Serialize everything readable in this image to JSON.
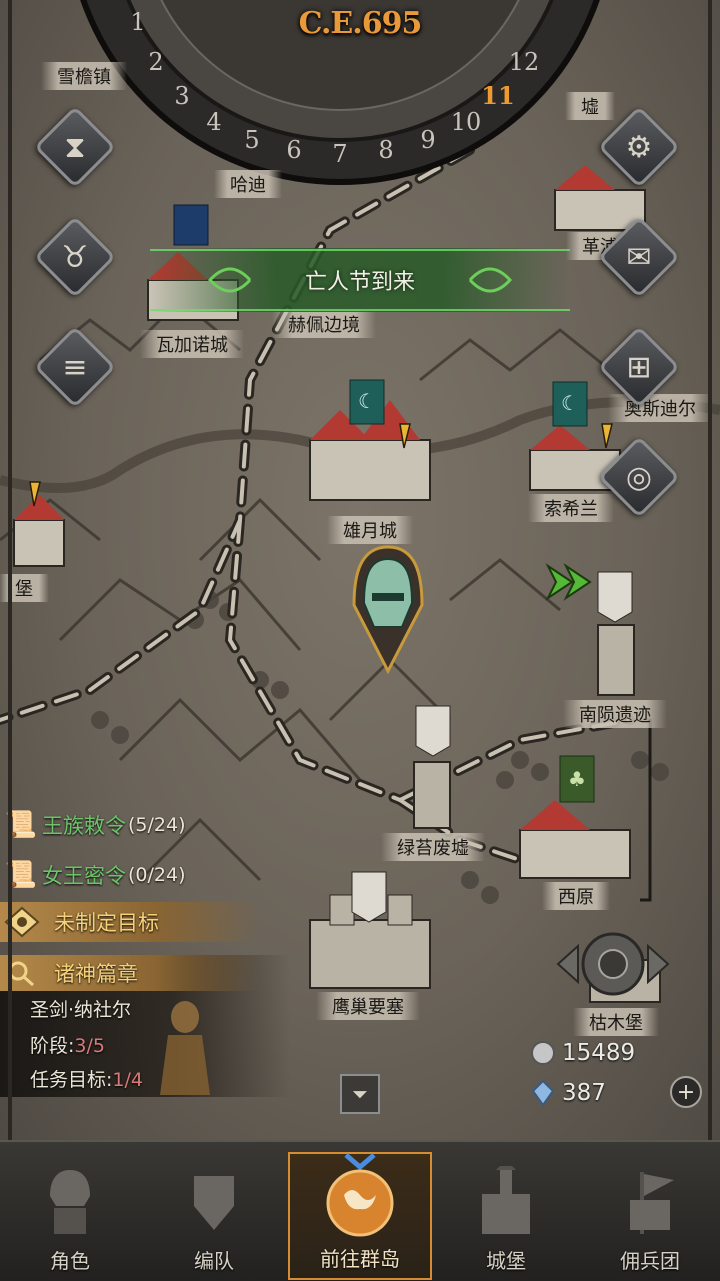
{
  "era": "C.E.695",
  "dial_numbers": [
    "1",
    "2",
    "3",
    "4",
    "5",
    "6",
    "7",
    "8",
    "9",
    "10",
    "11",
    "12"
  ],
  "current_month": "11",
  "festival_banner": "亡人节到来",
  "locations": {
    "xuejizhen": "雪檐镇",
    "hadao": "哈迪",
    "gexu": "墟",
    "gepu": "革浦",
    "wajianuo": "瓦加诺城",
    "hepei": "赫佩边境",
    "aosidier": "奥斯迪尔",
    "xiongyue": "雄月城",
    "suoxilan": "索希兰",
    "bao": "堡",
    "nanyun": "南陨遗迹",
    "lvtai": "绿苔废墟",
    "xiyuan": "西原",
    "yingchao": "鹰巢要塞",
    "kumu": "枯木堡"
  },
  "quests": [
    {
      "title": "王族敕令",
      "count": "(5/24)"
    },
    {
      "title": "女王密令",
      "count": "(0/24)"
    }
  ],
  "goal": "未制定目标",
  "lore": {
    "title": "诸神篇章",
    "name": "圣剑·纳社尔",
    "stage_label": "阶段:",
    "stage_value": "3/5",
    "target_label": "任务目标:",
    "target_value": "1/4"
  },
  "resources": {
    "silver": "15489",
    "crystal": "387"
  },
  "nav": [
    {
      "label": "角色"
    },
    {
      "label": "编队"
    },
    {
      "label": "前往群岛"
    },
    {
      "label": "城堡"
    },
    {
      "label": "佣兵团"
    }
  ],
  "colors": {
    "era": "#e89a3a",
    "quest_green": "#6cc36a",
    "goal_gold": "#f4d27a",
    "highlight": "#d77a7a"
  }
}
